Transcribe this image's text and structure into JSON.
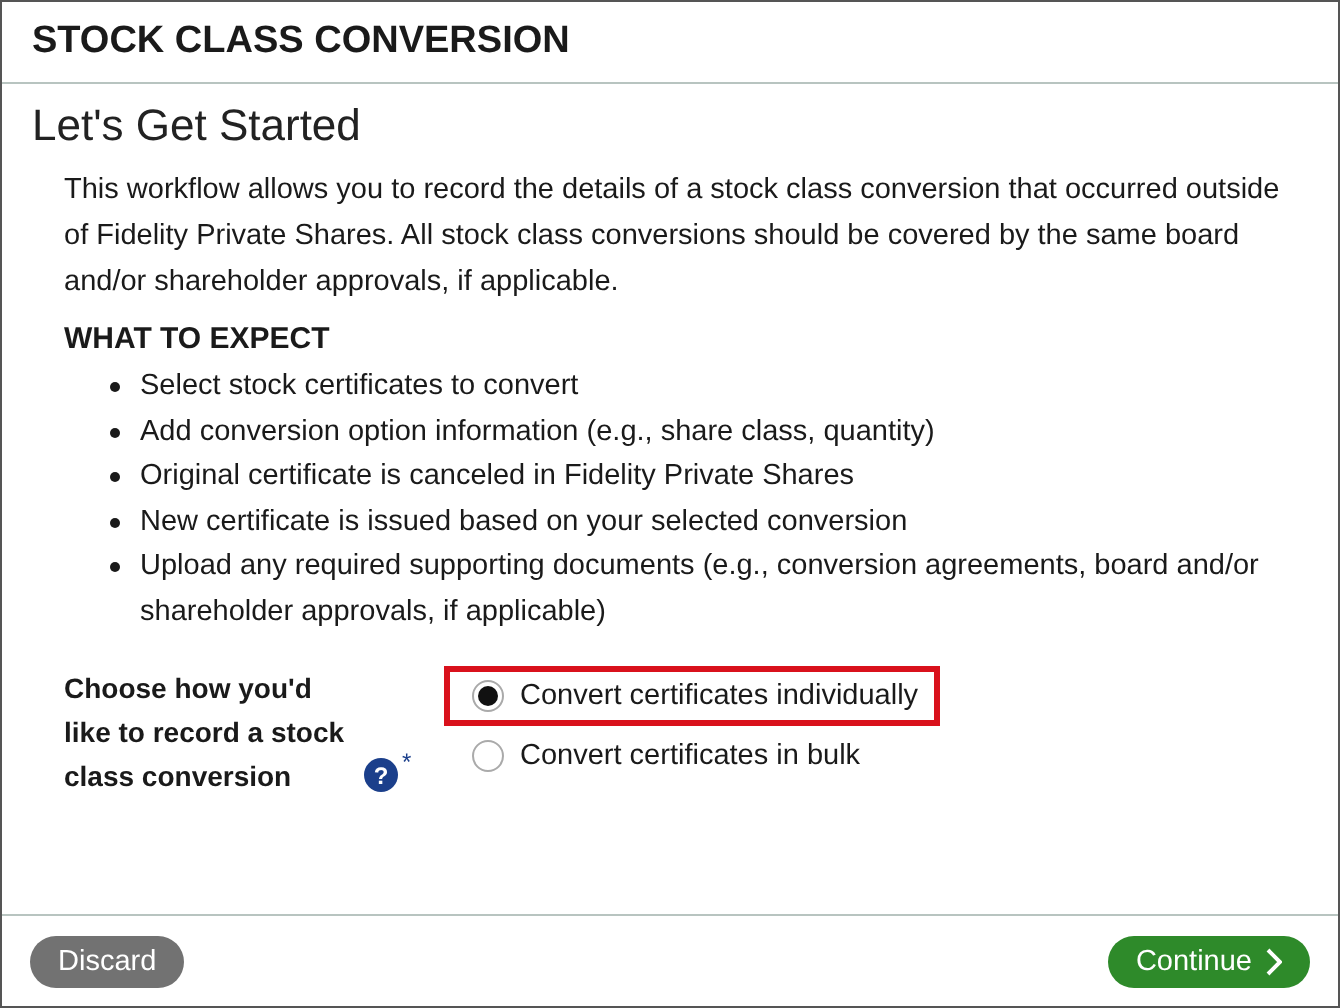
{
  "window": {
    "title": "STOCK CLASS CONVERSION"
  },
  "heading": "Let's Get Started",
  "intro": "This workflow allows you to record the details of a stock class conversion that occurred outside of Fidelity Private Shares. All stock class conversions should be covered by the same board and/or shareholder approvals, if applicable.",
  "expect": {
    "title": "WHAT TO EXPECT",
    "items": [
      "Select stock certificates to convert",
      "Add conversion option information (e.g., share class, quantity)",
      "Original certificate is canceled in Fidelity Private Shares",
      "New certificate is issued based on your selected conversion",
      "Upload any required supporting documents (e.g., conversion agreements, board and/or shareholder approvals, if applicable)"
    ]
  },
  "question": {
    "label": "Choose how you'd like to record a stock class conversion",
    "help": "?",
    "required": "*",
    "options": [
      {
        "label": "Convert certificates individually",
        "selected": true,
        "highlighted": true
      },
      {
        "label": "Convert certificates in bulk",
        "selected": false,
        "highlighted": false
      }
    ]
  },
  "buttons": {
    "discard": "Discard",
    "continue": "Continue"
  }
}
